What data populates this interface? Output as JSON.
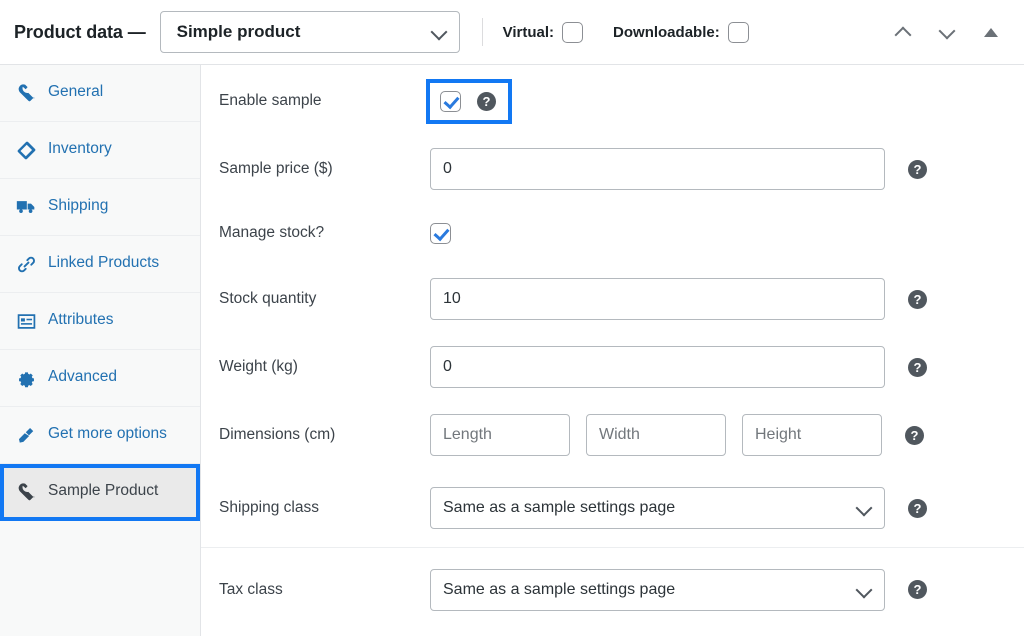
{
  "header": {
    "title": "Product data —",
    "product_type": {
      "value": "Simple product",
      "icon": "chevron-down-icon"
    },
    "virtual": {
      "label": "Virtual:",
      "checked": false
    },
    "downloadable": {
      "label": "Downloadable:",
      "checked": false
    },
    "controls": [
      "move-up-icon",
      "move-down-icon",
      "collapse-icon"
    ]
  },
  "sidebar": {
    "items": [
      {
        "label": "General",
        "icon": "wrench-icon",
        "active": false
      },
      {
        "label": "Inventory",
        "icon": "inventory-icon",
        "active": false
      },
      {
        "label": "Shipping",
        "icon": "truck-icon",
        "active": false
      },
      {
        "label": "Linked Products",
        "icon": "link-icon",
        "active": false
      },
      {
        "label": "Attributes",
        "icon": "attributes-icon",
        "active": false
      },
      {
        "label": "Advanced",
        "icon": "gear-icon",
        "active": false
      },
      {
        "label": "Get more options",
        "icon": "plug-icon",
        "active": false
      },
      {
        "label": "Sample Product",
        "icon": "wrench-icon",
        "active": true
      }
    ]
  },
  "main": {
    "fields": {
      "enable_sample": {
        "label": "Enable sample",
        "checked": true,
        "help": "?",
        "focused": true
      },
      "sample_price": {
        "label": "Sample price ($)",
        "value": "0",
        "placeholder": "",
        "help": "?"
      },
      "manage_stock": {
        "label": "Manage stock?",
        "checked": true
      },
      "stock_quantity": {
        "label": "Stock quantity",
        "value": "10",
        "placeholder": "",
        "help": "?"
      },
      "weight": {
        "label": "Weight (kg)",
        "value": "0",
        "placeholder": "",
        "help": "?"
      },
      "dimensions": {
        "label": "Dimensions (cm)",
        "length_placeholder": "Length",
        "width_placeholder": "Width",
        "height_placeholder": "Height",
        "length_value": "",
        "width_value": "",
        "height_value": "",
        "help": "?"
      },
      "shipping_class": {
        "label": "Shipping class",
        "value": "Same as a sample settings page",
        "help": "?",
        "icon": "chevron-down-icon"
      },
      "tax_class": {
        "label": "Tax class",
        "value": "Same as a sample settings page",
        "help": "?",
        "icon": "chevron-down-icon"
      }
    }
  },
  "colors": {
    "link": "#2271b1",
    "focus": "#1278f3",
    "checkmark": "#2a7ade",
    "text": "#3c434a",
    "sidebar_bg": "#f8f9f9",
    "active_bg": "#eaeaea"
  }
}
